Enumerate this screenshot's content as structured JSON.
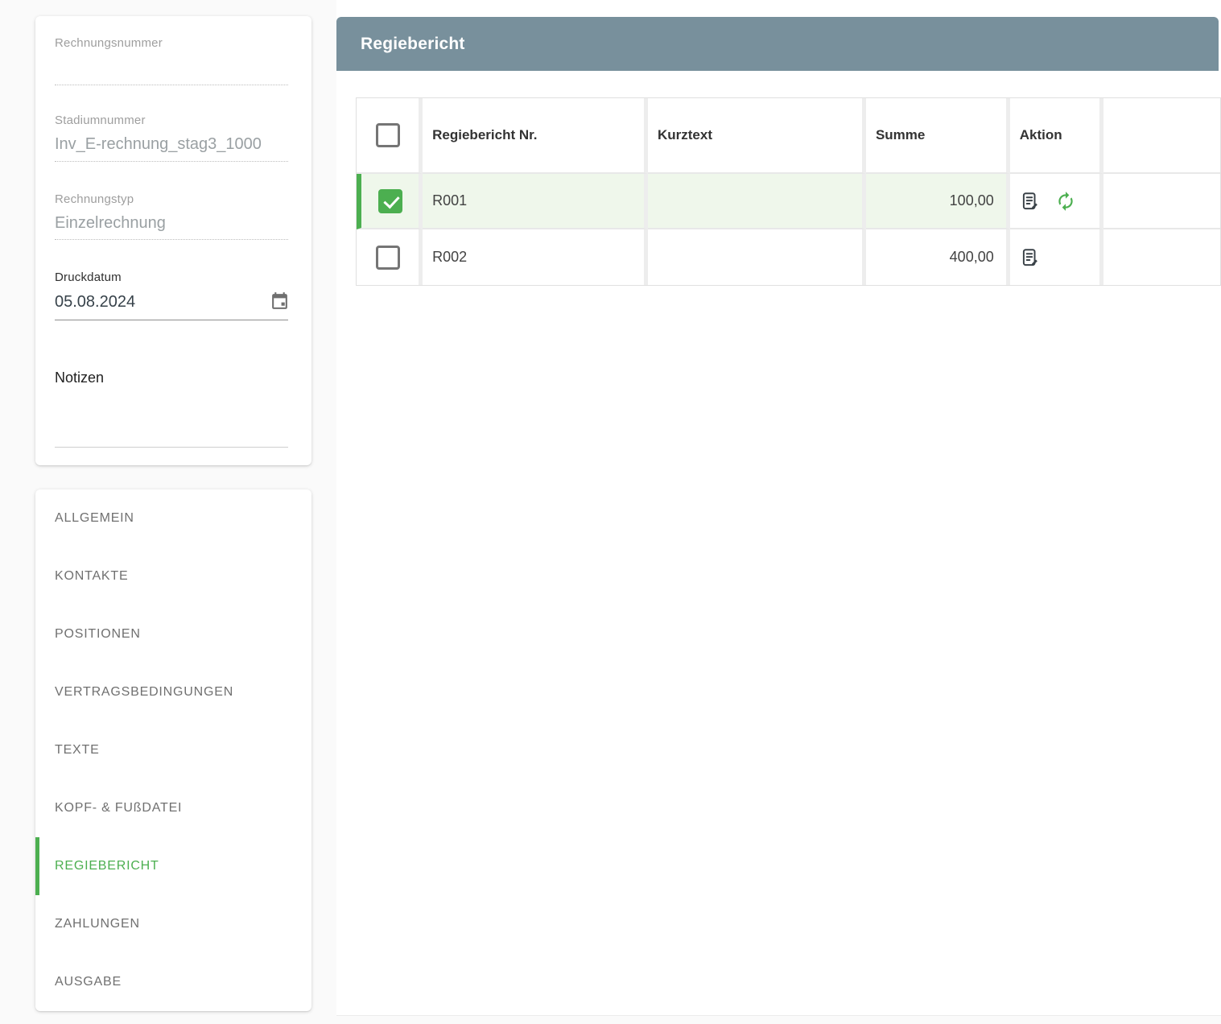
{
  "colors": {
    "accent_green": "#4caf50",
    "panel_header_bg": "#78909c",
    "selected_row_bg": "#eff7eb",
    "page_bg": "#fafafa"
  },
  "sidebar": {
    "form": {
      "fields": [
        {
          "label": "Rechnungsnummer",
          "value": ""
        },
        {
          "label": "Stadiumnummer",
          "value": "Inv_E-rechnung_stag3_1000"
        },
        {
          "label": "Rechnungstyp",
          "value": "Einzelrechnung"
        },
        {
          "label": "Druckdatum",
          "value": "05.08.2024"
        }
      ],
      "notes_label": "Notizen"
    },
    "nav": {
      "items": [
        {
          "label": "ALLGEMEIN",
          "active": false
        },
        {
          "label": "KONTAKTE",
          "active": false
        },
        {
          "label": "POSITIONEN",
          "active": false
        },
        {
          "label": "VERTRAGSBEDINGUNGEN",
          "active": false
        },
        {
          "label": "TEXTE",
          "active": false
        },
        {
          "label": "KOPF- & FUßDATEI",
          "active": false
        },
        {
          "label": "REGIEBERICHT",
          "active": true
        },
        {
          "label": "ZAHLUNGEN",
          "active": false
        },
        {
          "label": "AUSGABE",
          "active": false
        }
      ]
    }
  },
  "main": {
    "panel_title": "Regiebericht",
    "table": {
      "headers": {
        "nr": "Regiebericht Nr.",
        "kurztext": "Kurztext",
        "summe": "Summe",
        "aktion": "Aktion"
      },
      "rows": [
        {
          "nr": "R001",
          "kurztext": "",
          "summe": "100,00",
          "checked": true,
          "selected": true,
          "actions": [
            "edit-note-icon",
            "sync-icon"
          ]
        },
        {
          "nr": "R002",
          "kurztext": "",
          "summe": "400,00",
          "checked": false,
          "selected": false,
          "actions": [
            "edit-note-icon"
          ]
        }
      ]
    }
  }
}
